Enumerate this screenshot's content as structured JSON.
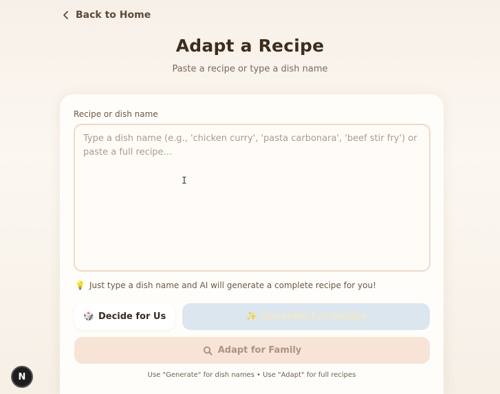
{
  "nav": {
    "back_label": "Back to Home"
  },
  "header": {
    "title": "Adapt a Recipe",
    "subtitle": "Paste a recipe or type a dish name"
  },
  "form": {
    "field_label": "Recipe or dish name",
    "placeholder": "Type a dish name (e.g., 'chicken curry', 'pasta carbonara', 'beef stir fry') or paste a full recipe...",
    "value": "",
    "hint": "Just type a dish name and AI will generate a complete recipe for you!"
  },
  "actions": {
    "decide_label": "Decide for Us",
    "generate_label": "Generate Full Recipe",
    "adapt_label": "Adapt for Family"
  },
  "footnote": "Use \"Generate\" for dish names • Use \"Adapt\" for full recipes",
  "badge": {
    "letter": "N"
  },
  "icons": {
    "back": "chevron-left-icon",
    "hint": "lightbulb-icon",
    "decide": "dice-icon",
    "generate": "sparkles-icon",
    "adapt": "magnifier-icon"
  },
  "colors": {
    "background": "#f7f0e8",
    "card": "#fffdf9",
    "textarea_border": "#f0d9c6",
    "generate_bg": "#dce6ef",
    "adapt_bg": "#f7e4d6",
    "title": "#3e2c1c"
  }
}
